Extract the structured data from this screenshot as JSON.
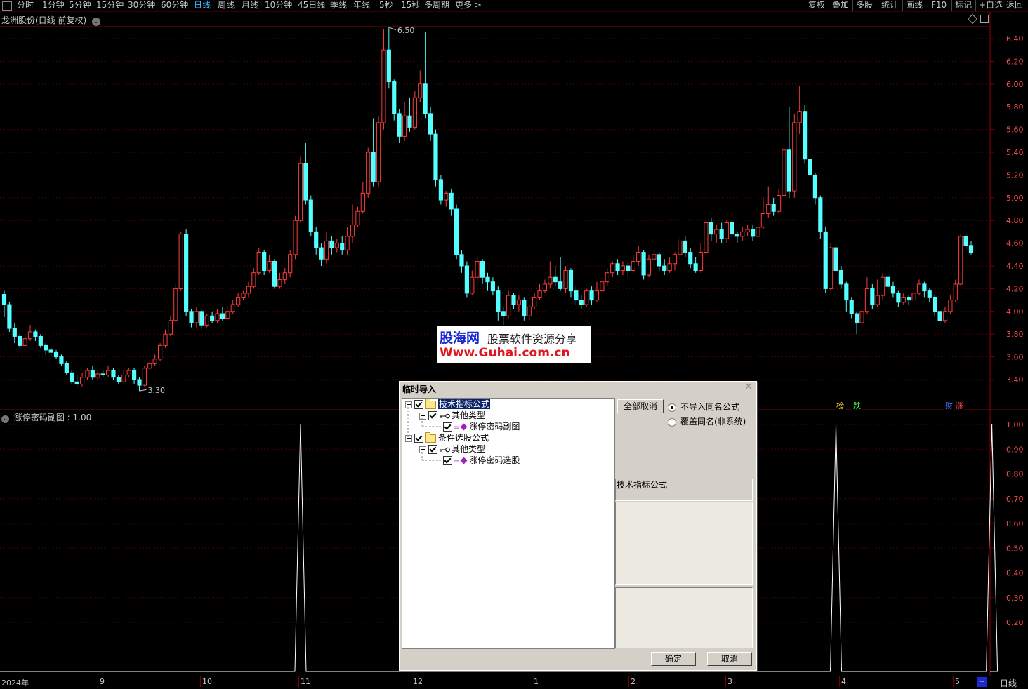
{
  "toolbar": {
    "left_tabs": [
      "分时",
      "1分钟",
      "5分钟",
      "15分钟",
      "30分钟",
      "60分钟",
      "日线",
      "周线",
      "月线",
      "10分钟",
      "45日线",
      "季线",
      "年线",
      "5秒",
      "15秒",
      "多周期",
      "更多 >"
    ],
    "active_tab": "日线",
    "right_tabs": [
      "复权",
      "叠加",
      "多股",
      "统计",
      "画线",
      "F10",
      "标记",
      "+自选",
      "返回"
    ]
  },
  "chart": {
    "title": "龙洲股份(日线 前复权)",
    "high_label": "6.50",
    "low_label": "3.30",
    "y_ticks": [
      "6.40",
      "6.20",
      "6.00",
      "5.80",
      "5.60",
      "5.40",
      "5.20",
      "5.00",
      "4.80",
      "4.60",
      "4.40",
      "4.20",
      "4.00",
      "3.80",
      "3.60",
      "3.40"
    ],
    "badges": [
      "榜",
      "跌",
      "财",
      "涨"
    ]
  },
  "subchart": {
    "title": "涨停密码副图 : 1.00",
    "y_ticks": [
      "1.00",
      "0.90",
      "0.80",
      "0.70",
      "0.60",
      "0.50",
      "0.40",
      "0.30",
      "0.20"
    ]
  },
  "x_axis": {
    "labels": [
      "2024年",
      "9",
      "10",
      "11",
      "12",
      "1",
      "2",
      "3",
      "4",
      "5"
    ]
  },
  "status": {
    "period": "日线",
    "indicator": "--"
  },
  "watermark": {
    "brand": "股海网",
    "slogan": "股票软件资源分享",
    "url": "Www.Guhai.com.cn"
  },
  "dialog": {
    "title": "临时导入",
    "tree": [
      {
        "label": "技术指标公式"
      },
      {
        "label": "其他类型"
      },
      {
        "label": "涨停密码副图"
      },
      {
        "label": "条件选股公式"
      },
      {
        "label": "其他类型"
      },
      {
        "label": "涨停密码选股"
      }
    ],
    "cancel_all_button": "全部取消",
    "radio_options": [
      "不导入同名公式",
      "覆盖同名(非系统)"
    ],
    "panel_label": "技术指标公式",
    "ok_button": "确定",
    "cancel_button": "取消"
  },
  "chart_data": {
    "type": "candlestick",
    "up_color": "#ff3c3c",
    "down_color": "#54ffff",
    "ylim": [
      3.3,
      6.5
    ],
    "candles": [
      [
        4.15,
        4.06,
        4.18,
        3.95
      ],
      [
        4.06,
        3.85,
        4.08,
        3.82
      ],
      [
        3.85,
        3.78,
        3.9,
        3.72
      ],
      [
        3.78,
        3.7,
        3.8,
        3.68
      ],
      [
        3.7,
        3.76,
        3.78,
        3.68
      ],
      [
        3.76,
        3.82,
        3.88,
        3.74
      ],
      [
        3.82,
        3.78,
        3.84,
        3.74
      ],
      [
        3.78,
        3.7,
        3.8,
        3.68
      ],
      [
        3.7,
        3.66,
        3.72,
        3.62
      ],
      [
        3.66,
        3.64,
        3.68,
        3.6
      ],
      [
        3.64,
        3.6,
        3.66,
        3.58
      ],
      [
        3.6,
        3.54,
        3.62,
        3.52
      ],
      [
        3.54,
        3.46,
        3.56,
        3.44
      ],
      [
        3.46,
        3.38,
        3.48,
        3.36
      ],
      [
        3.38,
        3.36,
        3.44,
        3.34
      ],
      [
        3.36,
        3.42,
        3.46,
        3.34
      ],
      [
        3.42,
        3.48,
        3.5,
        3.4
      ],
      [
        3.48,
        3.42,
        3.52,
        3.4
      ],
      [
        3.42,
        3.45,
        3.48,
        3.4
      ],
      [
        3.45,
        3.44,
        3.48,
        3.42
      ],
      [
        3.44,
        3.48,
        3.52,
        3.42
      ],
      [
        3.48,
        3.42,
        3.5,
        3.4
      ],
      [
        3.42,
        3.38,
        3.44,
        3.36
      ],
      [
        3.38,
        3.44,
        3.48,
        3.36
      ],
      [
        3.44,
        3.48,
        3.5,
        3.42
      ],
      [
        3.48,
        3.4,
        3.5,
        3.36
      ],
      [
        3.4,
        3.35,
        3.42,
        3.3
      ],
      [
        3.35,
        3.5,
        3.52,
        3.34
      ],
      [
        3.5,
        3.54,
        3.56,
        3.48
      ],
      [
        3.54,
        3.58,
        3.62,
        3.52
      ],
      [
        3.58,
        3.7,
        3.72,
        3.56
      ],
      [
        3.7,
        3.8,
        3.84,
        3.68
      ],
      [
        3.8,
        3.92,
        3.96,
        3.78
      ],
      [
        3.92,
        4.2,
        4.24,
        3.9
      ],
      [
        4.2,
        4.68,
        4.7,
        4.18
      ],
      [
        4.68,
        4.0,
        4.72,
        3.96
      ],
      [
        4.0,
        3.9,
        4.02,
        3.86
      ],
      [
        3.9,
        4.0,
        4.04,
        3.86
      ],
      [
        4.0,
        3.88,
        4.02,
        3.84
      ],
      [
        3.88,
        3.96,
        3.98,
        3.86
      ],
      [
        3.96,
        3.92,
        4.0,
        3.9
      ],
      [
        3.92,
        3.98,
        4.02,
        3.9
      ],
      [
        3.98,
        3.94,
        4.04,
        3.92
      ],
      [
        3.94,
        4.0,
        4.06,
        3.92
      ],
      [
        4.0,
        4.06,
        4.1,
        3.98
      ],
      [
        4.06,
        4.12,
        4.16,
        4.04
      ],
      [
        4.12,
        4.16,
        4.18,
        4.1
      ],
      [
        4.16,
        4.22,
        4.26,
        4.12
      ],
      [
        4.22,
        4.34,
        4.38,
        4.2
      ],
      [
        4.34,
        4.52,
        4.56,
        4.32
      ],
      [
        4.52,
        4.36,
        4.54,
        4.32
      ],
      [
        4.36,
        4.44,
        4.5,
        4.34
      ],
      [
        4.44,
        4.22,
        4.46,
        4.2
      ],
      [
        4.22,
        4.28,
        4.34,
        4.2
      ],
      [
        4.28,
        4.34,
        4.38,
        4.24
      ],
      [
        4.34,
        4.5,
        4.54,
        4.3
      ],
      [
        4.5,
        4.8,
        4.84,
        4.46
      ],
      [
        4.8,
        5.3,
        5.36,
        4.78
      ],
      [
        5.3,
        4.98,
        5.48,
        4.94
      ],
      [
        4.98,
        4.7,
        5.02,
        4.66
      ],
      [
        4.7,
        4.56,
        4.74,
        4.5
      ],
      [
        4.56,
        4.46,
        4.6,
        4.4
      ],
      [
        4.46,
        4.62,
        4.7,
        4.42
      ],
      [
        4.62,
        4.56,
        4.66,
        4.5
      ],
      [
        4.56,
        4.6,
        4.64,
        4.52
      ],
      [
        4.6,
        4.54,
        4.66,
        4.5
      ],
      [
        4.54,
        4.66,
        4.74,
        4.5
      ],
      [
        4.66,
        4.76,
        4.94,
        4.6
      ],
      [
        4.76,
        4.88,
        4.92,
        4.74
      ],
      [
        4.88,
        5.04,
        5.14,
        4.86
      ],
      [
        5.04,
        5.4,
        5.44,
        5.0
      ],
      [
        5.4,
        5.14,
        5.7,
        5.1
      ],
      [
        5.14,
        5.66,
        5.72,
        5.1
      ],
      [
        5.66,
        6.3,
        6.48,
        5.6
      ],
      [
        6.3,
        6.02,
        6.5,
        5.96
      ],
      [
        6.02,
        5.74,
        6.04,
        5.68
      ],
      [
        5.74,
        5.54,
        5.78,
        5.48
      ],
      [
        5.54,
        5.72,
        5.84,
        5.5
      ],
      [
        5.72,
        5.62,
        5.88,
        5.58
      ],
      [
        5.62,
        5.88,
        5.94,
        5.6
      ],
      [
        5.88,
        6.0,
        6.12,
        5.84
      ],
      [
        6.0,
        5.74,
        6.46,
        5.7
      ],
      [
        5.74,
        5.56,
        5.8,
        5.5
      ],
      [
        5.56,
        5.16,
        5.6,
        5.1
      ],
      [
        5.16,
        4.98,
        5.2,
        4.94
      ],
      [
        4.98,
        5.04,
        5.06,
        4.92
      ],
      [
        5.04,
        4.9,
        5.08,
        4.84
      ],
      [
        4.9,
        4.5,
        4.94,
        4.46
      ],
      [
        4.5,
        4.4,
        4.54,
        4.34
      ],
      [
        4.4,
        4.16,
        4.44,
        4.12
      ],
      [
        4.16,
        4.3,
        4.36,
        4.14
      ],
      [
        4.3,
        4.44,
        4.48,
        4.26
      ],
      [
        4.44,
        4.3,
        4.46,
        4.24
      ],
      [
        4.3,
        4.26,
        4.34,
        4.18
      ],
      [
        4.26,
        4.18,
        4.3,
        4.14
      ],
      [
        4.18,
        4.0,
        4.22,
        3.92
      ],
      [
        4.0,
        3.96,
        4.04,
        3.88
      ],
      [
        3.96,
        4.14,
        4.18,
        3.94
      ],
      [
        4.14,
        4.06,
        4.16,
        4.02
      ],
      [
        4.06,
        4.1,
        4.14,
        4.0
      ],
      [
        4.1,
        3.96,
        4.12,
        3.92
      ],
      [
        3.96,
        4.04,
        4.06,
        3.92
      ],
      [
        4.04,
        4.12,
        4.16,
        4.02
      ],
      [
        4.12,
        4.18,
        4.24,
        4.1
      ],
      [
        4.18,
        4.24,
        4.28,
        4.16
      ],
      [
        4.24,
        4.3,
        4.44,
        4.2
      ],
      [
        4.3,
        4.26,
        4.4,
        4.22
      ],
      [
        4.26,
        4.2,
        4.48,
        4.18
      ],
      [
        4.2,
        4.36,
        4.4,
        4.16
      ],
      [
        4.36,
        4.18,
        4.38,
        4.12
      ],
      [
        4.18,
        4.1,
        4.22,
        4.06
      ],
      [
        4.1,
        4.06,
        4.14,
        4.02
      ],
      [
        4.06,
        4.18,
        4.2,
        4.04
      ],
      [
        4.18,
        4.1,
        4.22,
        4.06
      ],
      [
        4.1,
        4.18,
        4.26,
        4.08
      ],
      [
        4.18,
        4.26,
        4.3,
        4.16
      ],
      [
        4.26,
        4.34,
        4.38,
        4.22
      ],
      [
        4.34,
        4.42,
        4.44,
        4.3
      ],
      [
        4.42,
        4.36,
        4.46,
        4.32
      ],
      [
        4.36,
        4.4,
        4.44,
        4.32
      ],
      [
        4.4,
        4.36,
        4.44,
        4.3
      ],
      [
        4.36,
        4.44,
        4.5,
        4.34
      ],
      [
        4.44,
        4.52,
        4.58,
        4.4
      ],
      [
        4.52,
        4.32,
        4.54,
        4.28
      ],
      [
        4.32,
        4.46,
        4.5,
        4.3
      ],
      [
        4.46,
        4.5,
        4.54,
        4.38
      ],
      [
        4.5,
        4.4,
        4.52,
        4.36
      ],
      [
        4.4,
        4.36,
        4.46,
        4.32
      ],
      [
        4.36,
        4.42,
        4.48,
        4.34
      ],
      [
        4.42,
        4.5,
        4.52,
        4.36
      ],
      [
        4.5,
        4.62,
        4.66,
        4.46
      ],
      [
        4.62,
        4.52,
        4.66,
        4.48
      ],
      [
        4.52,
        4.42,
        4.56,
        4.38
      ],
      [
        4.42,
        4.36,
        4.48,
        4.34
      ],
      [
        4.36,
        4.52,
        4.6,
        4.34
      ],
      [
        4.52,
        4.78,
        4.82,
        4.5
      ],
      [
        4.78,
        4.68,
        4.82,
        4.62
      ],
      [
        4.68,
        4.72,
        4.76,
        4.6
      ],
      [
        4.72,
        4.64,
        4.78,
        4.6
      ],
      [
        4.64,
        4.78,
        4.8,
        4.6
      ],
      [
        4.78,
        4.68,
        4.8,
        4.62
      ],
      [
        4.68,
        4.66,
        4.7,
        4.6
      ],
      [
        4.66,
        4.7,
        4.74,
        4.62
      ],
      [
        4.7,
        4.72,
        4.76,
        4.66
      ],
      [
        4.72,
        4.66,
        4.76,
        4.62
      ],
      [
        4.66,
        4.74,
        4.82,
        4.64
      ],
      [
        4.74,
        4.86,
        5.0,
        4.72
      ],
      [
        4.86,
        4.94,
        5.1,
        4.82
      ],
      [
        4.94,
        4.88,
        5.0,
        4.84
      ],
      [
        4.88,
        5.02,
        5.08,
        4.86
      ],
      [
        5.02,
        5.42,
        5.62,
        5.0
      ],
      [
        5.42,
        5.06,
        5.8,
        5.0
      ],
      [
        5.06,
        5.66,
        5.74,
        5.0
      ],
      [
        5.66,
        5.76,
        5.98,
        5.56
      ],
      [
        5.76,
        5.34,
        5.82,
        5.3
      ],
      [
        5.34,
        5.2,
        5.36,
        5.14
      ],
      [
        5.2,
        5.0,
        5.22,
        4.94
      ],
      [
        5.0,
        4.7,
        5.02,
        4.64
      ],
      [
        4.7,
        4.2,
        4.74,
        4.16
      ],
      [
        4.2,
        4.56,
        4.6,
        4.18
      ],
      [
        4.56,
        4.36,
        4.6,
        4.32
      ],
      [
        4.36,
        4.24,
        4.4,
        4.2
      ],
      [
        4.24,
        4.1,
        4.26,
        4.0
      ],
      [
        4.1,
        3.98,
        4.12,
        3.94
      ],
      [
        3.98,
        3.9,
        4.0,
        3.8
      ],
      [
        3.9,
        4.0,
        4.02,
        3.84
      ],
      [
        4.0,
        4.2,
        4.3,
        3.98
      ],
      [
        4.2,
        4.06,
        4.24,
        4.02
      ],
      [
        4.06,
        4.14,
        4.28,
        4.04
      ],
      [
        4.14,
        4.3,
        4.34,
        4.1
      ],
      [
        4.3,
        4.22,
        4.32,
        4.18
      ],
      [
        4.22,
        4.16,
        4.26,
        4.12
      ],
      [
        4.16,
        4.08,
        4.18,
        4.04
      ],
      [
        4.08,
        4.12,
        4.16,
        4.06
      ],
      [
        4.12,
        4.1,
        4.14,
        4.06
      ],
      [
        4.1,
        4.16,
        4.3,
        4.08
      ],
      [
        4.16,
        4.24,
        4.28,
        4.14
      ],
      [
        4.24,
        4.18,
        4.26,
        4.12
      ],
      [
        4.18,
        4.12,
        4.2,
        4.08
      ],
      [
        4.12,
        4.0,
        4.14,
        3.96
      ],
      [
        4.0,
        3.92,
        4.02,
        3.88
      ],
      [
        3.92,
        4.0,
        4.04,
        3.9
      ],
      [
        4.0,
        4.1,
        4.14,
        3.98
      ],
      [
        4.1,
        4.24,
        4.28,
        4.08
      ],
      [
        4.24,
        4.66,
        4.68,
        4.22
      ],
      [
        4.66,
        4.58,
        4.68,
        4.54
      ],
      [
        4.58,
        4.52,
        4.62,
        4.5
      ]
    ],
    "sub_spikes": [
      {
        "candle_index": 57,
        "value": 1.0
      },
      {
        "candle_index": 160,
        "value": 1.0
      },
      {
        "candle_index": 190,
        "value": 1.0
      }
    ]
  }
}
